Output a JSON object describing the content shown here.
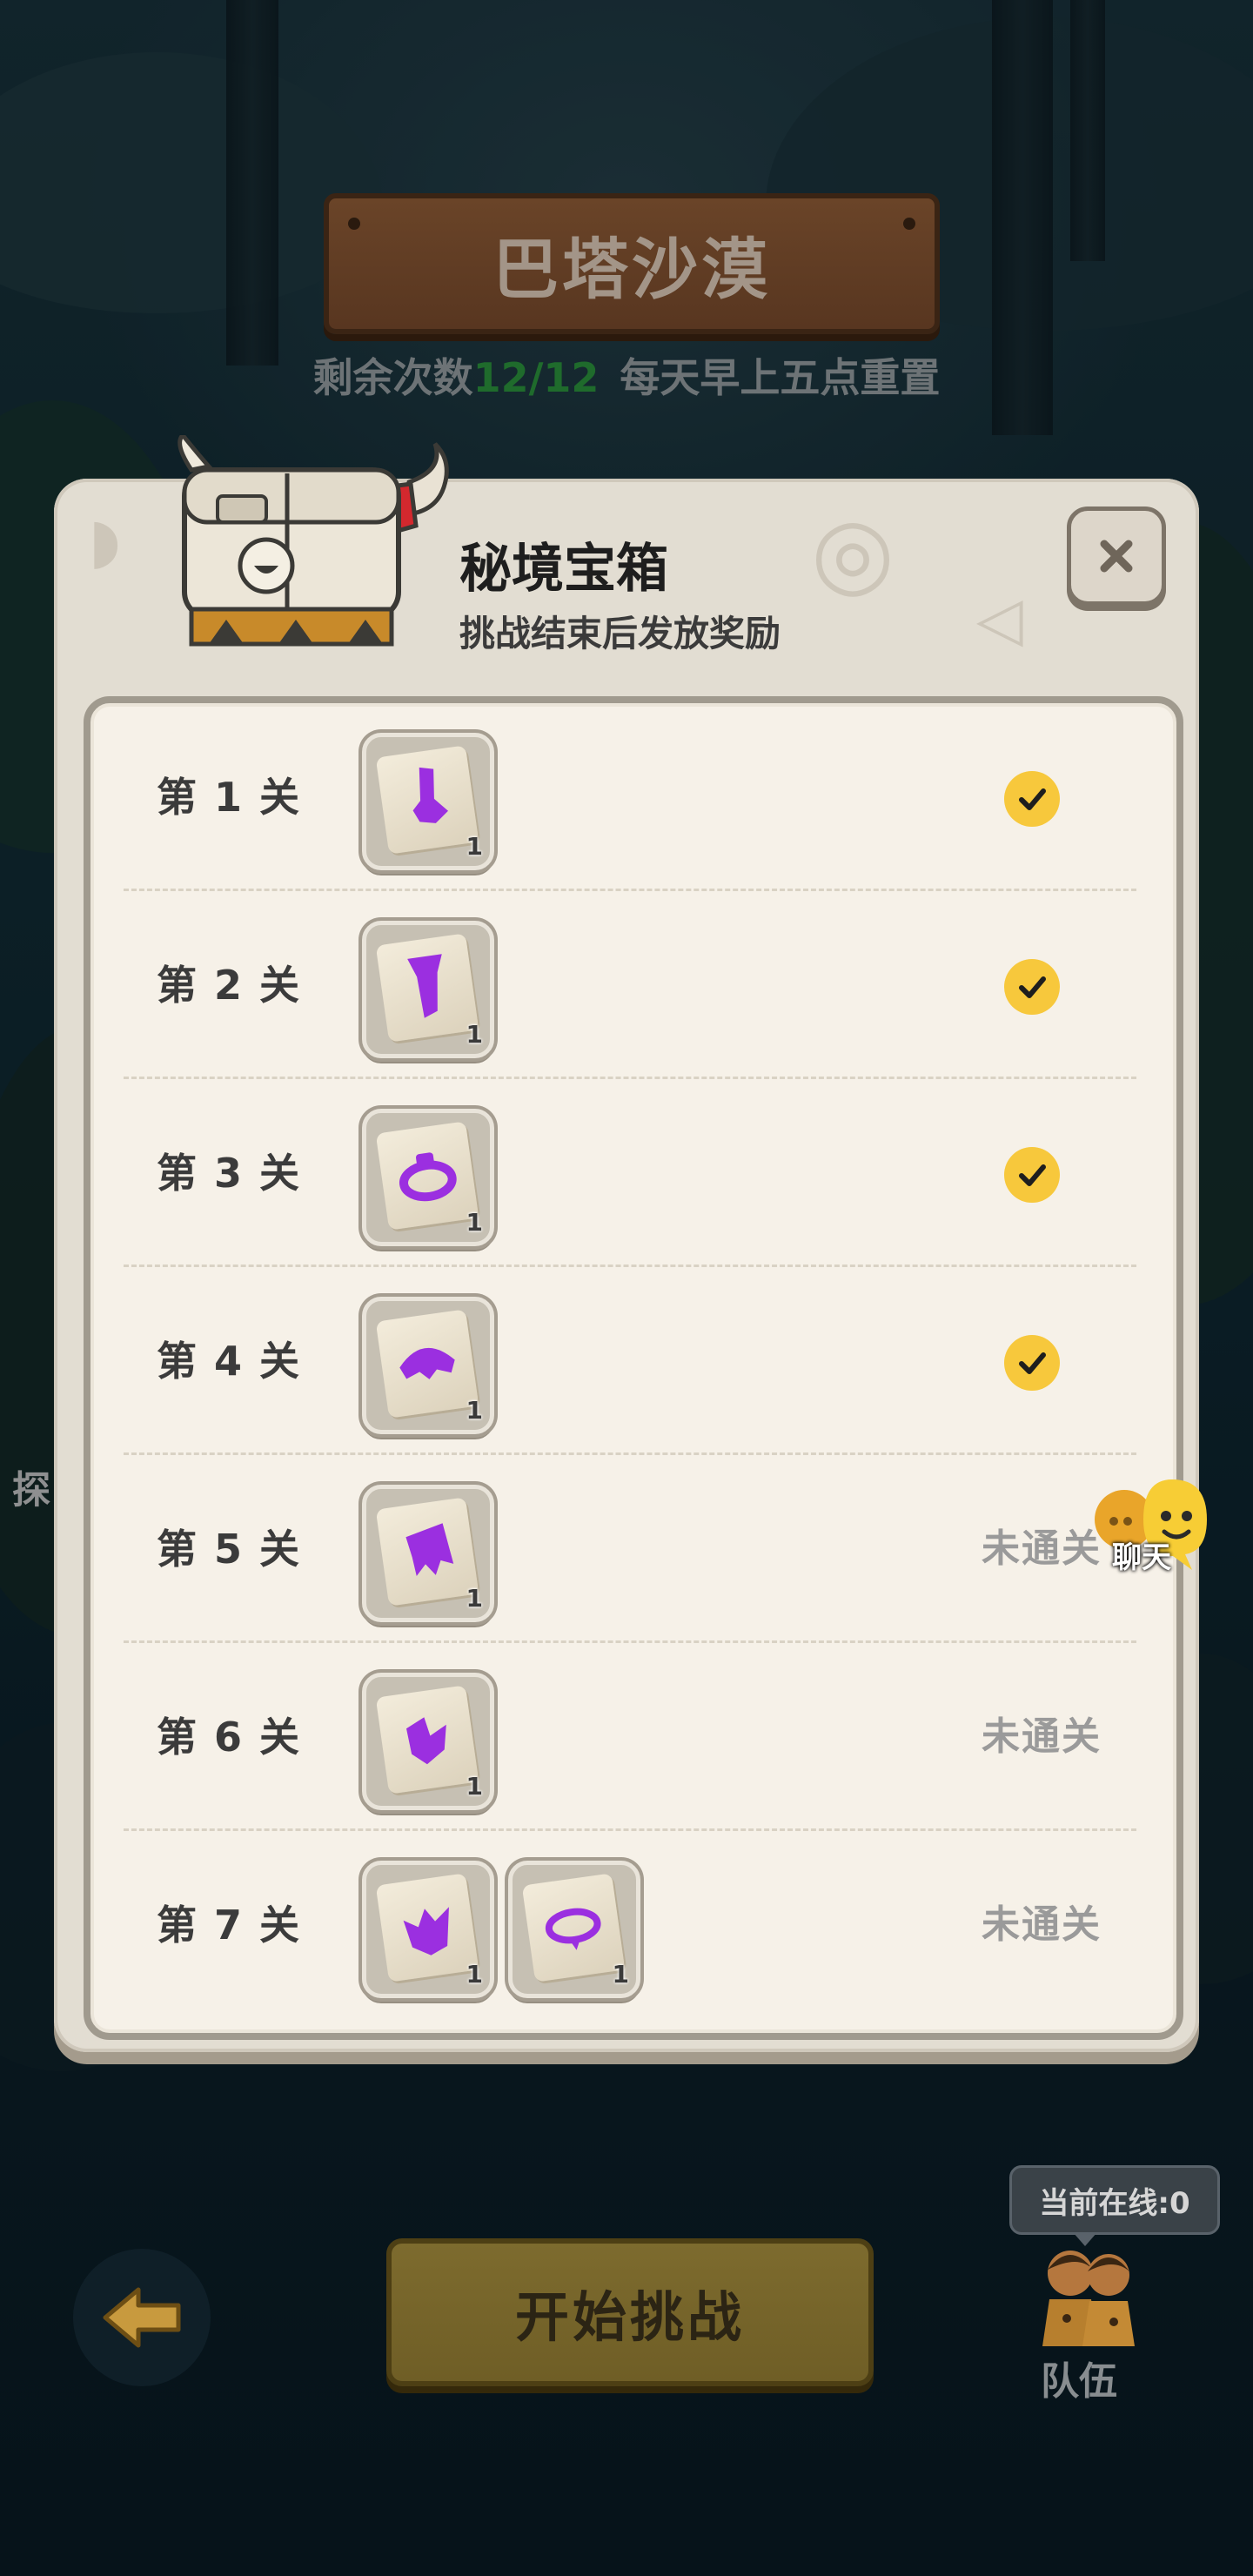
{
  "stage": {
    "title": "巴塔沙漠",
    "remaining_prefix": "剩余次数",
    "remaining_count": "12/12",
    "reset_note": "每天早上五点重置"
  },
  "modal": {
    "title": "秘境宝箱",
    "subtitle": "挑战结束后发放奖励",
    "close_icon": "close-icon",
    "levels": [
      {
        "label": "第 1 关",
        "rewards": [
          {
            "icon": "boot-fragment-icon",
            "qty": "1"
          }
        ],
        "status": "cleared",
        "status_text": ""
      },
      {
        "label": "第 2 关",
        "rewards": [
          {
            "icon": "leg-armor-fragment-icon",
            "qty": "1"
          }
        ],
        "status": "cleared",
        "status_text": ""
      },
      {
        "label": "第 3 关",
        "rewards": [
          {
            "icon": "ring-fragment-icon",
            "qty": "1"
          }
        ],
        "status": "cleared",
        "status_text": ""
      },
      {
        "label": "第 4 关",
        "rewards": [
          {
            "icon": "helmet-fragment-icon",
            "qty": "1"
          }
        ],
        "status": "cleared",
        "status_text": ""
      },
      {
        "label": "第 5 关",
        "rewards": [
          {
            "icon": "cape-fragment-icon",
            "qty": "1"
          }
        ],
        "status": "locked",
        "status_text": "未通关"
      },
      {
        "label": "第 6 关",
        "rewards": [
          {
            "icon": "gloves-fragment-icon",
            "qty": "1"
          }
        ],
        "status": "locked",
        "status_text": "未通关"
      },
      {
        "label": "第 7 关",
        "rewards": [
          {
            "icon": "armor-fragment-icon",
            "qty": "1"
          },
          {
            "icon": "necklace-fragment-icon",
            "qty": "1"
          }
        ],
        "status": "locked",
        "status_text": "未通关"
      }
    ]
  },
  "side_peek_text": "探",
  "chat": {
    "label": "聊天"
  },
  "bottom": {
    "back_icon": "back-arrow-icon",
    "start_label": "开始挑战",
    "online_text": "当前在线:0",
    "team_label": "队伍"
  },
  "colors": {
    "check": "#f7c83c",
    "reward_item": "#9b2fe0",
    "count_green": "#1f6b2c"
  }
}
